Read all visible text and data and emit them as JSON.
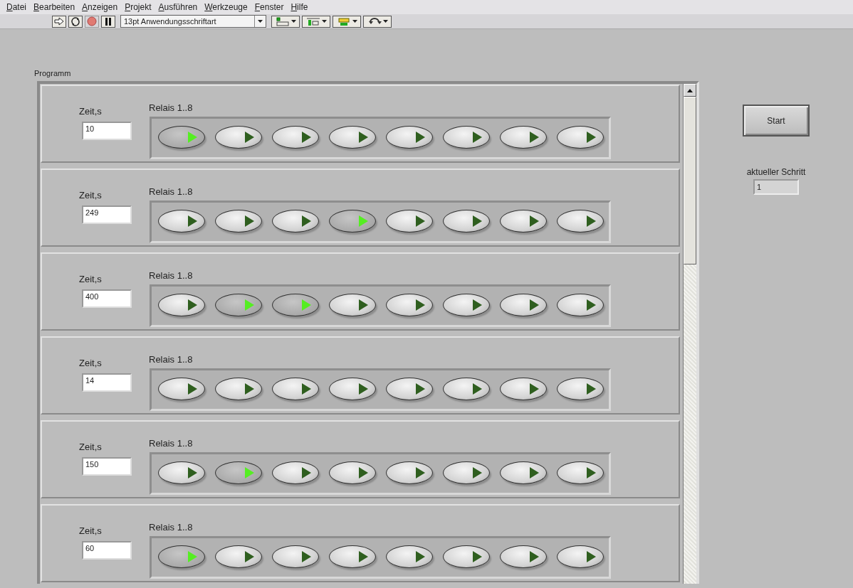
{
  "menu": [
    "Datei",
    "Bearbeiten",
    "Anzeigen",
    "Projekt",
    "Ausführen",
    "Werkzeuge",
    "Fenster",
    "Hilfe"
  ],
  "toolbar": {
    "font": "13pt Anwendungsschriftart"
  },
  "program": {
    "label": "Programm",
    "rows": [
      {
        "time_label": "Zeit,s",
        "time": "10",
        "relays_label": "Relais 1..8",
        "relays": [
          {
            "on": true
          },
          {
            "on": false
          },
          {
            "on": false
          },
          {
            "on": false
          },
          {
            "on": false
          },
          {
            "on": false
          },
          {
            "on": false
          },
          {
            "on": false
          }
        ]
      },
      {
        "time_label": "Zeit,s",
        "time": "249",
        "relays_label": "Relais 1..8",
        "relays": [
          {
            "on": false
          },
          {
            "on": false
          },
          {
            "on": false
          },
          {
            "on": true
          },
          {
            "on": false
          },
          {
            "on": false
          },
          {
            "on": false
          },
          {
            "on": false
          }
        ]
      },
      {
        "time_label": "Zeit,s",
        "time": "400",
        "relays_label": "Relais 1..8",
        "relays": [
          {
            "on": false
          },
          {
            "on": true
          },
          {
            "on": true
          },
          {
            "on": false
          },
          {
            "on": false
          },
          {
            "on": false
          },
          {
            "on": false
          },
          {
            "on": false
          }
        ]
      },
      {
        "time_label": "Zeit,s",
        "time": "14",
        "relays_label": "Relais 1..8",
        "relays": [
          {
            "on": false
          },
          {
            "on": false
          },
          {
            "on": false
          },
          {
            "on": false
          },
          {
            "on": false
          },
          {
            "on": false
          },
          {
            "on": false
          },
          {
            "on": false
          }
        ]
      },
      {
        "time_label": "Zeit,s",
        "time": "150",
        "relays_label": "Relais 1..8",
        "relays": [
          {
            "on": false
          },
          {
            "on": true
          },
          {
            "on": false
          },
          {
            "on": false
          },
          {
            "on": false
          },
          {
            "on": false
          },
          {
            "on": false
          },
          {
            "on": false
          }
        ]
      },
      {
        "time_label": "Zeit,s",
        "time": "60",
        "relays_label": "Relais 1..8",
        "relays": [
          {
            "on": true
          },
          {
            "on": false
          },
          {
            "on": false
          },
          {
            "on": false
          },
          {
            "on": false
          },
          {
            "on": false
          },
          {
            "on": false
          },
          {
            "on": false
          }
        ]
      }
    ]
  },
  "start_button": "Start",
  "current_step": {
    "label": "aktueller Schritt",
    "value": "1"
  }
}
